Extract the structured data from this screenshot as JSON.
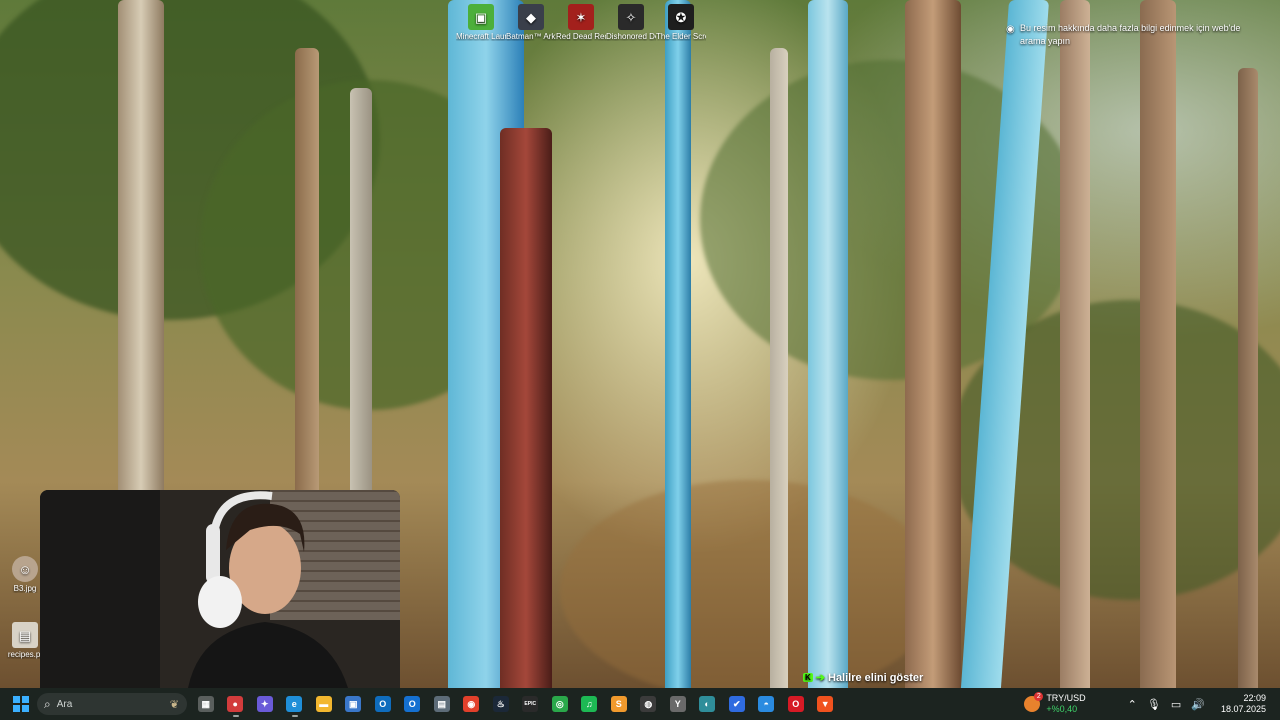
{
  "desktop": {
    "icons": [
      {
        "label": "Minecraft Launcher",
        "icon": "minecraft-icon",
        "color": "#4caf3a"
      },
      {
        "label": "Batman™ Arkham A...",
        "icon": "batman-icon",
        "color": "#3a3f4a"
      },
      {
        "label": "Red Dead Redempti...",
        "icon": "red-dead-icon",
        "color": "#a3201c"
      },
      {
        "label": "Dishonored Definitive E...",
        "icon": "dishonored-icon",
        "color": "#2a2a2a"
      },
      {
        "label": "The Elder Scrolls ...",
        "icon": "elder-scrolls-icon",
        "color": "#1e1e1e"
      }
    ],
    "side_icons": [
      {
        "label": "B3.jpg",
        "icon": "image-file-icon"
      },
      {
        "label": "recipes.pi",
        "icon": "file-icon"
      }
    ],
    "spotlight_text": "Bu resim hakkında daha fazla bilgi edinmek için web'de arama yapın"
  },
  "stream_overlay": {
    "badge": "K",
    "name": "Halilre",
    "message": "elini göster"
  },
  "taskbar": {
    "search_placeholder": "Ara",
    "apps": [
      {
        "name": "task-view",
        "glyph": "▦",
        "color": "#5a5f5d"
      },
      {
        "name": "widget-app",
        "glyph": "●",
        "color": "#d23c3c"
      },
      {
        "name": "copilot",
        "glyph": "✦",
        "color": "#6a5bd8"
      },
      {
        "name": "edge",
        "glyph": "e",
        "color": "#1f8fd8"
      },
      {
        "name": "file-explorer",
        "glyph": "▬",
        "color": "#f2b72f"
      },
      {
        "name": "microsoft-store",
        "glyph": "▣",
        "color": "#3a77c9"
      },
      {
        "name": "outlook",
        "glyph": "O",
        "color": "#0f6cbd"
      },
      {
        "name": "outlook-classic",
        "glyph": "O",
        "color": "#1570d1"
      },
      {
        "name": "calculator",
        "glyph": "▤",
        "color": "#5d6c78"
      },
      {
        "name": "chrome",
        "glyph": "◉",
        "color": "#e2402b"
      },
      {
        "name": "steam",
        "glyph": "♨",
        "color": "#1b2838"
      },
      {
        "name": "epic-games",
        "glyph": "EPIC",
        "color": "#2a2a2a"
      },
      {
        "name": "xbox-app",
        "glyph": "◎",
        "color": "#2aa84a"
      },
      {
        "name": "spotify",
        "glyph": "♫",
        "color": "#1db954"
      },
      {
        "name": "sublime-text",
        "glyph": "S",
        "color": "#f19a2d"
      },
      {
        "name": "obs-studio",
        "glyph": "◍",
        "color": "#3b3b3b"
      },
      {
        "name": "gog-galaxy",
        "glyph": "Y",
        "color": "#6a6a6a"
      },
      {
        "name": "world-app",
        "glyph": "◐",
        "color": "#2f8e9a"
      },
      {
        "name": "todo",
        "glyph": "✔",
        "color": "#2f6be0"
      },
      {
        "name": "messenger",
        "glyph": "◓",
        "color": "#2a8be0"
      },
      {
        "name": "opera",
        "glyph": "O",
        "color": "#d61a25"
      },
      {
        "name": "brave",
        "glyph": "▼",
        "color": "#f0521e"
      }
    ],
    "currency": {
      "badge_count": "2",
      "pair": "TRY/USD",
      "change": "+%0,40"
    },
    "clock": {
      "time": "22:09",
      "date": "18.07.2025"
    }
  }
}
